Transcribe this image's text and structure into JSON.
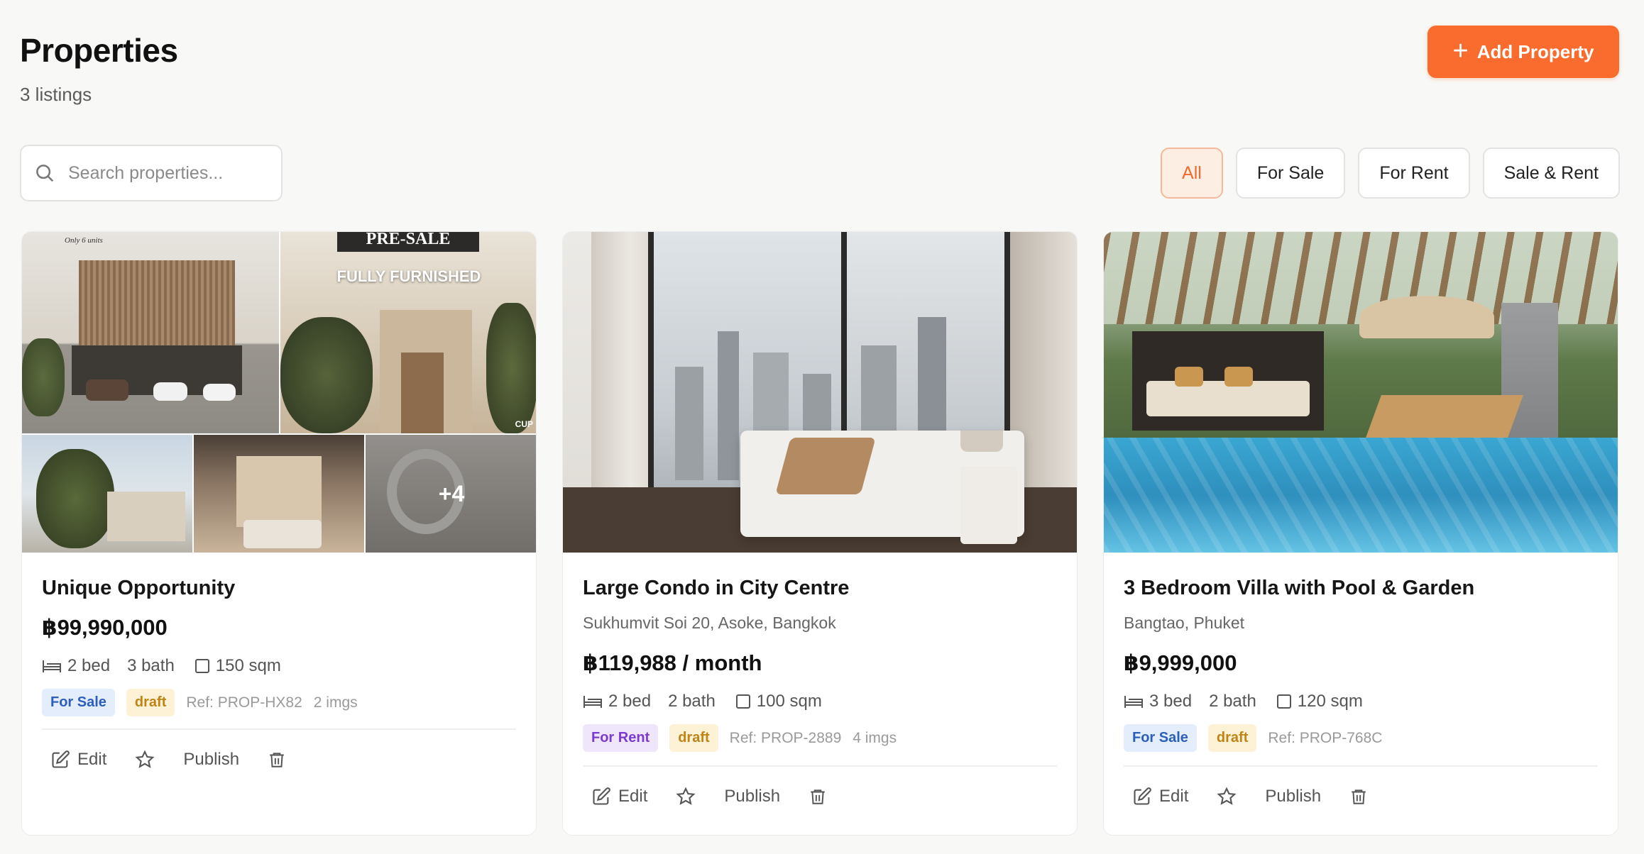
{
  "header": {
    "title": "Properties",
    "subtitle": "3 listings",
    "add_button": "Add Property"
  },
  "search": {
    "placeholder": "Search properties..."
  },
  "filters": [
    "All",
    "For Sale",
    "For Rent",
    "Sale & Rent"
  ],
  "active_filter": "All",
  "colors": {
    "accent": "#fa6c2d",
    "sale_badge": "#e3edfb",
    "rent_badge": "#efe6fb",
    "draft_badge": "#fdf2d6"
  },
  "actions": {
    "edit": "Edit",
    "publish": "Publish"
  },
  "listings": [
    {
      "title": "Unique Opportunity",
      "location": "",
      "price": "฿99,990,000",
      "beds": "2 bed",
      "baths": "3 bath",
      "area": "150 sqm",
      "type": "For Sale",
      "status": "draft",
      "ref": "Ref: PROP-HX82",
      "imgs": "2 imgs",
      "gallery_overlay": "+4",
      "gallery_text": {
        "presale": "PRE-SALE",
        "furnished": "FULLY FURNISHED",
        "tag1": "Only 6 units",
        "brand": "CUP"
      }
    },
    {
      "title": "Large Condo in City Centre",
      "location": "Sukhumvit Soi 20, Asoke, Bangkok",
      "price": "฿119,988 / month",
      "beds": "2 bed",
      "baths": "2 bath",
      "area": "100 sqm",
      "type": "For Rent",
      "status": "draft",
      "ref": "Ref: PROP-2889",
      "imgs": "4 imgs"
    },
    {
      "title": "3 Bedroom Villa with Pool & Garden",
      "location": "Bangtao, Phuket",
      "price": "฿9,999,000",
      "beds": "3 bed",
      "baths": "2 bath",
      "area": "120 sqm",
      "type": "For Sale",
      "status": "draft",
      "ref": "Ref: PROP-768C",
      "imgs": ""
    }
  ]
}
